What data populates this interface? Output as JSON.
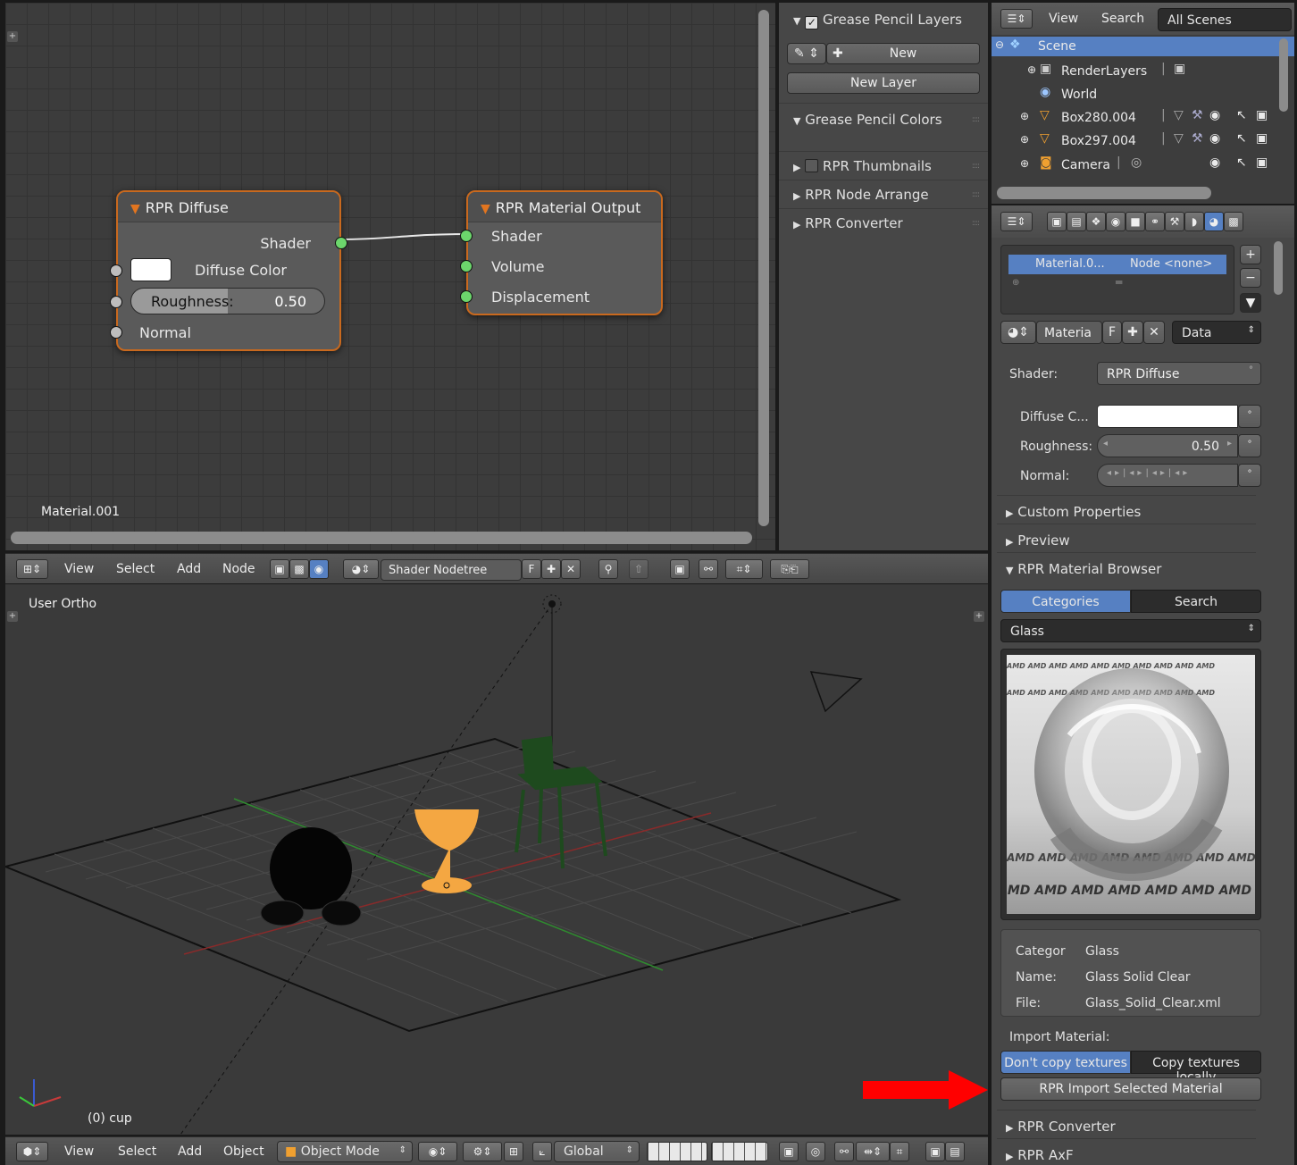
{
  "node_editor": {
    "material_name": "Material.001",
    "diffuse_node": {
      "title": "RPR Diffuse",
      "output_shader": "Shader",
      "diffuse_color": "Diffuse Color",
      "roughness_label": "Roughness:",
      "roughness_value": "0.50",
      "normal": "Normal"
    },
    "output_node": {
      "title": "RPR Material Output",
      "shader": "Shader",
      "volume": "Volume",
      "displacement": "Displacement"
    }
  },
  "tool_panel": {
    "grease_pencil_layers": "Grease Pencil Layers",
    "new_button": "New",
    "new_layer_button": "New Layer",
    "grease_pencil_colors": "Grease Pencil Colors",
    "rpr_thumbnails": "RPR Thumbnails",
    "rpr_node_arrange": "RPR Node Arrange",
    "rpr_converter": "RPR Converter"
  },
  "outliner": {
    "menu_view": "View",
    "menu_search": "Search",
    "scene_select": "All Scenes",
    "rows": [
      {
        "label": "Scene"
      },
      {
        "label": "RenderLayers"
      },
      {
        "label": "World"
      },
      {
        "label": "Box280.004"
      },
      {
        "label": "Box297.004"
      },
      {
        "label": "Camera"
      }
    ]
  },
  "properties": {
    "material_slot": "Material.0...",
    "node_slot": "Node <none>",
    "material_field": "Materia",
    "fake_user": "F",
    "data_select": "Data",
    "shader_label": "Shader:",
    "shader_value": "RPR Diffuse",
    "diffuse_label": "Diffuse C...",
    "roughness_label": "Roughness:",
    "roughness_value": "0.50",
    "normal_label": "Normal:",
    "custom_properties": "Custom Properties",
    "preview": "Preview",
    "material_browser": "RPR Material Browser",
    "tab_categories": "Categories",
    "tab_search": "Search",
    "category_select": "Glass",
    "info": {
      "category_label": "Categor",
      "category_value": "Glass",
      "name_label": "Name:",
      "name_value": "Glass Solid Clear",
      "file_label": "File:",
      "file_value": "Glass_Solid_Clear.xml"
    },
    "import_material_label": "Import Material:",
    "dont_copy": "Don't copy textures",
    "copy_local": "Copy textures locally",
    "import_button": "RPR Import Selected Material",
    "rpr_converter": "RPR Converter",
    "rpr_axf": "RPR AxF",
    "preview_watermark": "AMD AMD AMD AMD AMD AMD AMD AMD AMD AMD"
  },
  "node_header": {
    "view": "View",
    "select": "Select",
    "add": "Add",
    "node": "Node",
    "tree_name": "Shader Nodetree",
    "fake_user": "F"
  },
  "viewport": {
    "view_name": "User Ortho",
    "object_info": "(0) cup"
  },
  "viewport_header": {
    "view": "View",
    "select": "Select",
    "add": "Add",
    "object": "Object",
    "mode": "Object Mode",
    "orientation": "Global"
  },
  "colors": {
    "node_border": "#c9691e",
    "socket_green": "#6cd66c",
    "selection_blue": "#5680c2",
    "arrow_red": "#ff0000",
    "cup_orange": "#f4a742",
    "chair_green": "#1e4a1e"
  }
}
